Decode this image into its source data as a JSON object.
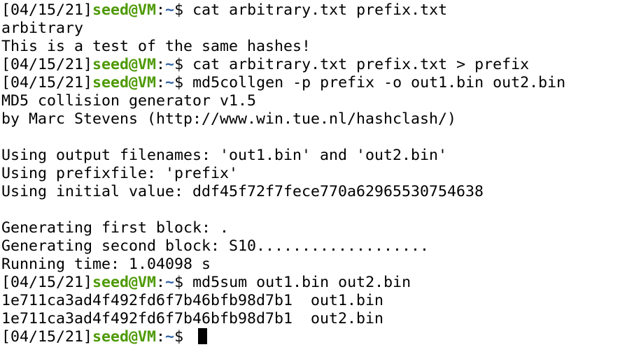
{
  "terminal": {
    "prompt_timestamp": "[04/15/21]",
    "prompt_user": "seed@VM",
    "prompt_colon": ":",
    "prompt_path": "~",
    "prompt_symbol": "$ ",
    "lines": [
      {
        "type": "prompt",
        "command": "cat arbitrary.txt prefix.txt"
      },
      {
        "type": "output",
        "text": "arbitrary"
      },
      {
        "type": "output",
        "text": "This is a test of the same hashes!"
      },
      {
        "type": "prompt",
        "command": "cat arbitrary.txt prefix.txt > prefix"
      },
      {
        "type": "prompt",
        "command": "md5collgen -p prefix -o out1.bin out2.bin"
      },
      {
        "type": "output",
        "text": "MD5 collision generator v1.5"
      },
      {
        "type": "output",
        "text": "by Marc Stevens (http://www.win.tue.nl/hashclash/)"
      },
      {
        "type": "output",
        "text": ""
      },
      {
        "type": "output",
        "text": "Using output filenames: 'out1.bin' and 'out2.bin'"
      },
      {
        "type": "output",
        "text": "Using prefixfile: 'prefix'"
      },
      {
        "type": "output",
        "text": "Using initial value: ddf45f72f7fece770a62965530754638"
      },
      {
        "type": "output",
        "text": ""
      },
      {
        "type": "output",
        "text": "Generating first block: ."
      },
      {
        "type": "output",
        "text": "Generating second block: S10..................."
      },
      {
        "type": "output",
        "text": "Running time: 1.04098 s"
      },
      {
        "type": "prompt",
        "command": "md5sum out1.bin out2.bin"
      },
      {
        "type": "output",
        "text": "1e711ca3ad4f492fd6f7b46bfb98d7b1  out1.bin"
      },
      {
        "type": "output",
        "text": "1e711ca3ad4f492fd6f7b46bfb98d7b1  out2.bin"
      },
      {
        "type": "prompt",
        "command": "",
        "cursor": true
      }
    ],
    "colors": {
      "background": "#ffffff",
      "foreground": "#000000",
      "user": "#4e9a06",
      "path": "#3465a4"
    }
  }
}
